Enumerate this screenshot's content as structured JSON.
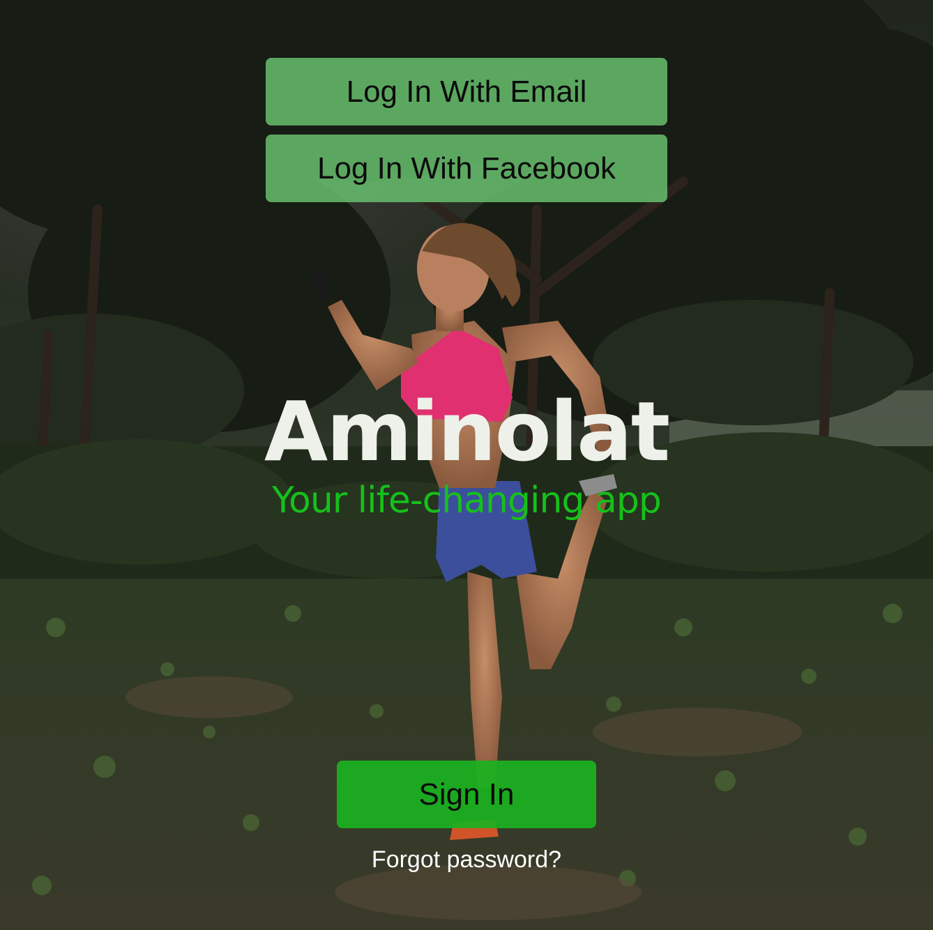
{
  "auth": {
    "email_button_label": "Log In With Email",
    "facebook_button_label": "Log In With Facebook",
    "sign_in_label": "Sign In",
    "forgot_password_label": "Forgot password?"
  },
  "branding": {
    "app_name": "Aminolat",
    "tagline": "Your life-changing app"
  },
  "colors": {
    "login_button_bg": "#66BE6E",
    "sign_in_button_bg": "#1AB220",
    "tagline": "#16C01A",
    "app_name": "#EEF0EA"
  },
  "background": {
    "subject": "woman stretching outdoors while holding a phone in a wooded field"
  }
}
